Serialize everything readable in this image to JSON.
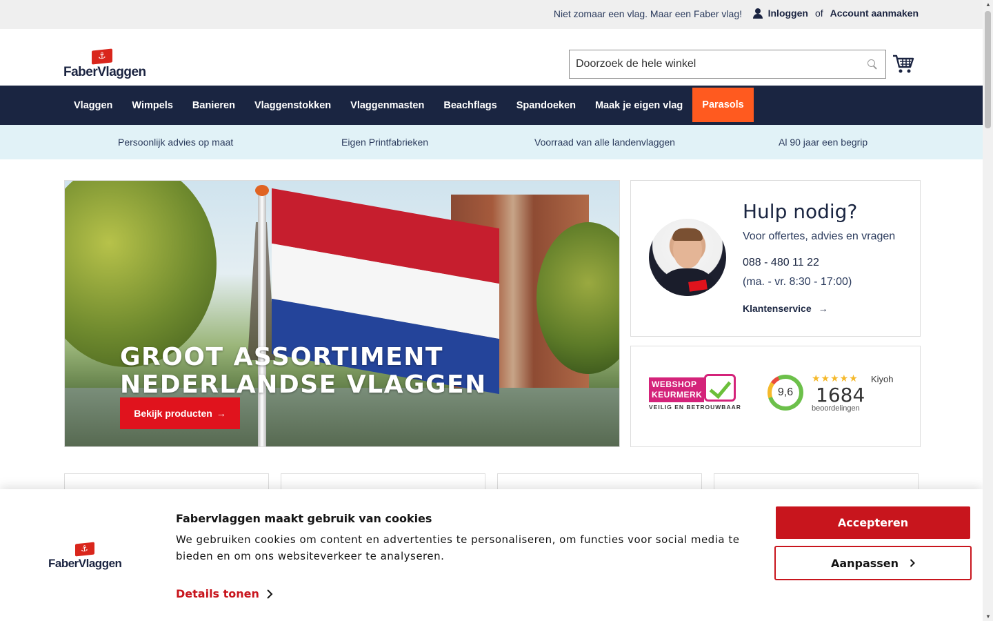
{
  "topbar": {
    "slogan": "Niet zomaar een vlag. Maar een Faber vlag!",
    "login": "Inloggen",
    "or": "of",
    "create_account": "Account aanmaken"
  },
  "header": {
    "logo_text": "FaberVlaggen",
    "search_placeholder": "Doorzoek de hele winkel"
  },
  "nav": {
    "items": [
      "Vlaggen",
      "Wimpels",
      "Banieren",
      "Vlaggenstokken",
      "Vlaggenmasten",
      "Beachflags",
      "Spandoeken",
      "Maak je eigen vlag",
      "Parasols"
    ],
    "highlight_color": "#ff5a1f"
  },
  "usp": [
    "Persoonlijk advies op maat",
    "Eigen Printfabrieken",
    "Voorraad van alle landenvlaggen",
    "Al 90 jaar een begrip"
  ],
  "hero": {
    "title_line1": "GROOT ASSORTIMENT",
    "title_line2": "NEDERLANDSE VLAGGEN",
    "cta": "Bekijk producten"
  },
  "help": {
    "title": "Hulp nodig?",
    "subtitle": "Voor offertes, advies en vragen",
    "phone": "088 - 480 11 22",
    "hours": "(ma. - vr. 8:30 - 17:00)",
    "link": "Klantenservice"
  },
  "trust": {
    "keurmerk_line1": "WEBSHOP",
    "keurmerk_line2": "KEURMERK",
    "keurmerk_tagline": "VEILIG EN BETROUWBAAR",
    "kiyoh_score": "9,6",
    "kiyoh_name": "Kiyoh",
    "kiyoh_stars": "★★★★★",
    "kiyoh_count": "1684",
    "kiyoh_label": "beoordelingen"
  },
  "cookie": {
    "logo_text": "FaberVlaggen",
    "title": "Fabervlaggen maakt gebruik van cookies",
    "text": "We gebruiken cookies om content en advertenties te personaliseren, om functies voor social media te bieden en om ons websiteverkeer te analyseren.",
    "details": "Details tonen",
    "accept": "Accepteren",
    "adjust": "Aanpassen"
  },
  "colors": {
    "navy": "#1a2541",
    "brand_red": "#c8151d",
    "usp_bg": "#e1f2f7"
  }
}
